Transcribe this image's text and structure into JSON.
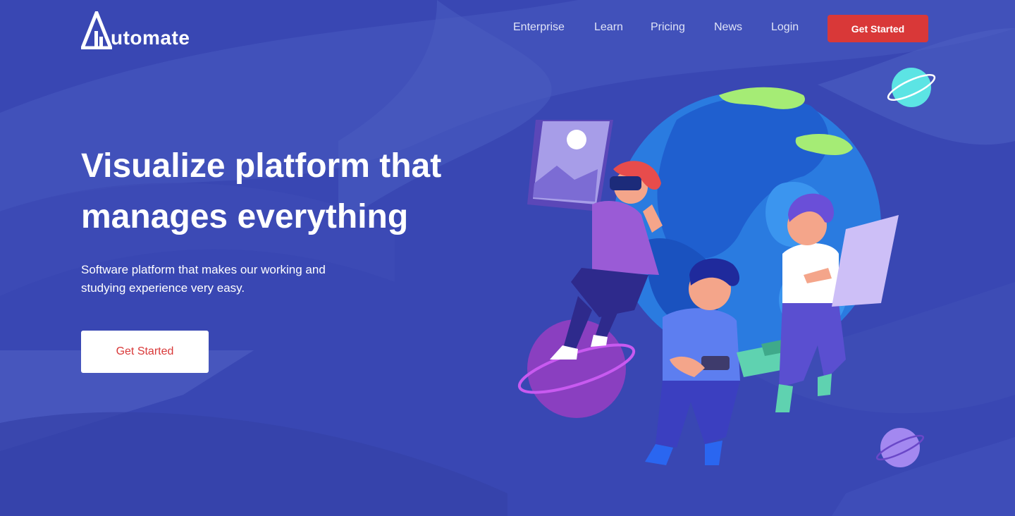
{
  "brand": {
    "logo_letter": "A",
    "name": "utomate"
  },
  "nav": {
    "links": [
      "Enterprise",
      "Learn",
      "Pricing",
      "News",
      "Login"
    ],
    "cta_label": "Get Started"
  },
  "hero": {
    "title_line1": "Visualize platform that",
    "title_line2": "manages everything",
    "subtitle_line1": "Software platform that makes our working and",
    "subtitle_line2": "studying experience very easy.",
    "cta_label": "Get Started"
  },
  "colors": {
    "background": "#3948b4",
    "accent": "#d93838",
    "text": "#ffffff",
    "nav_text": "#dfe3f7"
  },
  "icons": {
    "logo": "automate-logo-icon",
    "illustration": "people-globe-illustration"
  }
}
